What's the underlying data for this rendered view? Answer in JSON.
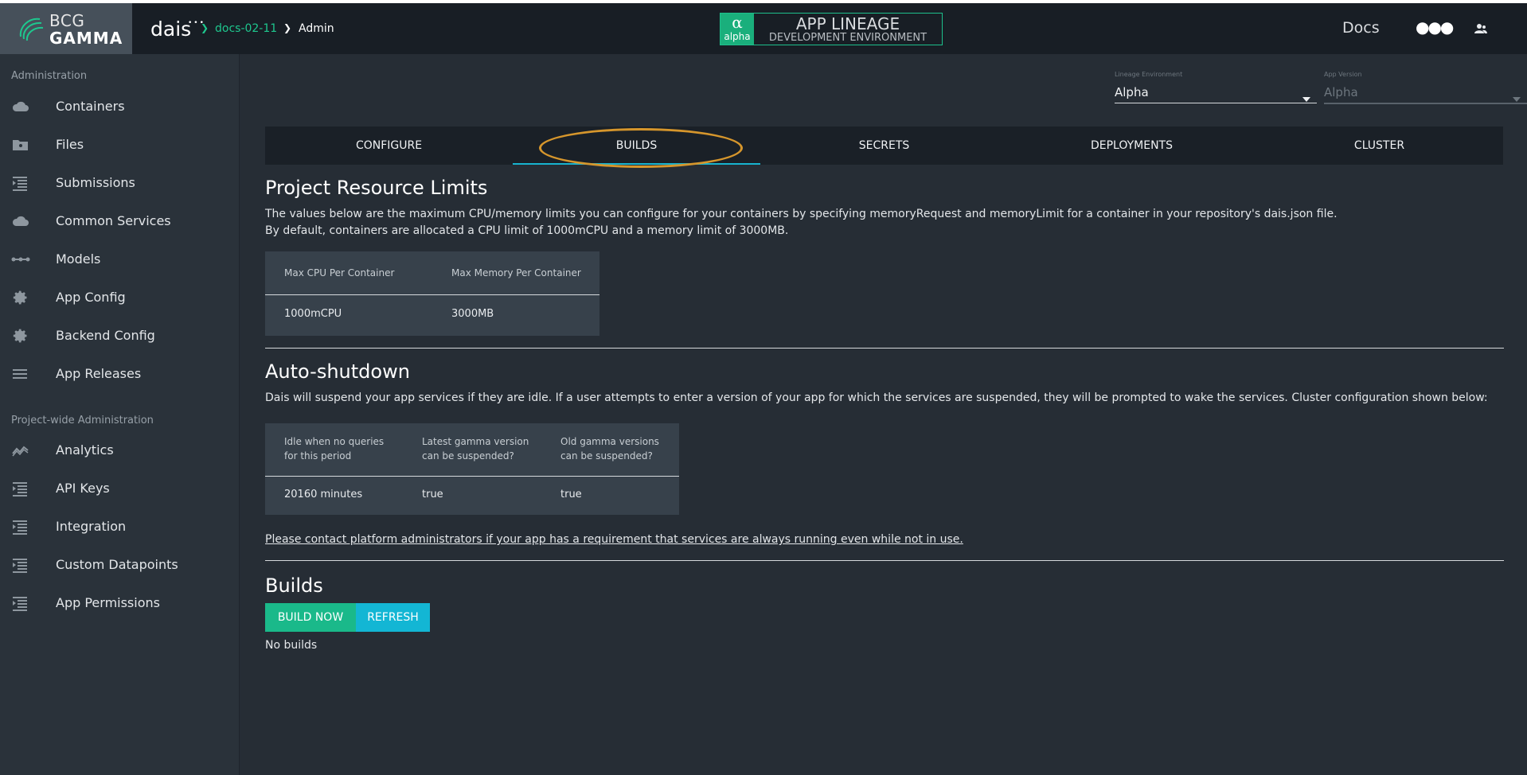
{
  "logo": {
    "line1": "BCG",
    "line2": "GAMMA"
  },
  "brand": {
    "name": "dais",
    "dots": "•••"
  },
  "breadcrumb": {
    "project": "docs-02-11",
    "page": "Admin"
  },
  "environment_badge": {
    "symbol": "α",
    "symbol_label": "alpha",
    "title": "APP LINEAGE",
    "subtitle": "DEVELOPMENT ENVIRONMENT"
  },
  "header": {
    "docs_label": "Docs",
    "more_label": "●●●"
  },
  "sidebar": {
    "section1": "Administration",
    "items1": [
      {
        "label": "Containers",
        "icon": "cloud-icon"
      },
      {
        "label": "Files",
        "icon": "folder-icon"
      },
      {
        "label": "Submissions",
        "icon": "list-icon"
      },
      {
        "label": "Common Services",
        "icon": "cloud-icon"
      },
      {
        "label": "Models",
        "icon": "models-icon"
      },
      {
        "label": "App Config",
        "icon": "gear-icon"
      },
      {
        "label": "Backend Config",
        "icon": "gear-icon"
      },
      {
        "label": "App Releases",
        "icon": "menu-icon"
      }
    ],
    "section2": "Project-wide Administration",
    "items2": [
      {
        "label": "Analytics",
        "icon": "analytics-icon"
      },
      {
        "label": "API Keys",
        "icon": "list-icon"
      },
      {
        "label": "Integration",
        "icon": "list-icon"
      },
      {
        "label": "Custom Datapoints",
        "icon": "list-icon"
      },
      {
        "label": "App Permissions",
        "icon": "list-icon"
      }
    ]
  },
  "selectors": {
    "lineage_label": "Lineage Environment",
    "lineage_value": "Alpha",
    "version_label": "App Version",
    "version_value": "Alpha"
  },
  "tabs": [
    "CONFIGURE",
    "BUILDS",
    "SECRETS",
    "DEPLOYMENTS",
    "CLUSTER"
  ],
  "active_tab": "BUILDS",
  "limits": {
    "title": "Project Resource Limits",
    "line1": "The values below are the maximum CPU/memory limits you can configure for your containers by specifying memoryRequest and memoryLimit for a container in your repository's dais.json file.",
    "line2": "By default, containers are allocated a CPU limit of 1000mCPU and a memory limit of 3000MB.",
    "headers": [
      "Max CPU Per Container",
      "Max Memory Per Container"
    ],
    "values": [
      "1000mCPU",
      "3000MB"
    ]
  },
  "shutdown": {
    "title": "Auto-shutdown",
    "text": "Dais will suspend your app services if they are idle. If a user attempts to enter a version of your app for which the services are suspended, they will be prompted to wake the services. Cluster configuration shown below:",
    "headers": [
      [
        "Idle when no queries",
        "for this period"
      ],
      [
        "Latest gamma version",
        "can be suspended?"
      ],
      [
        "Old gamma versions",
        "can be suspended?"
      ]
    ],
    "values": [
      "20160 minutes",
      "true",
      "true"
    ],
    "contact": "Please contact platform administrators if your app has a requirement that services are always running even while not in use."
  },
  "builds": {
    "title": "Builds",
    "build_now": "BUILD NOW",
    "refresh": "REFRESH",
    "empty": "No builds"
  },
  "colors": {
    "accent_green": "#1ec78e",
    "accent_cyan": "#13b6d4",
    "highlight": "#d6962c"
  }
}
